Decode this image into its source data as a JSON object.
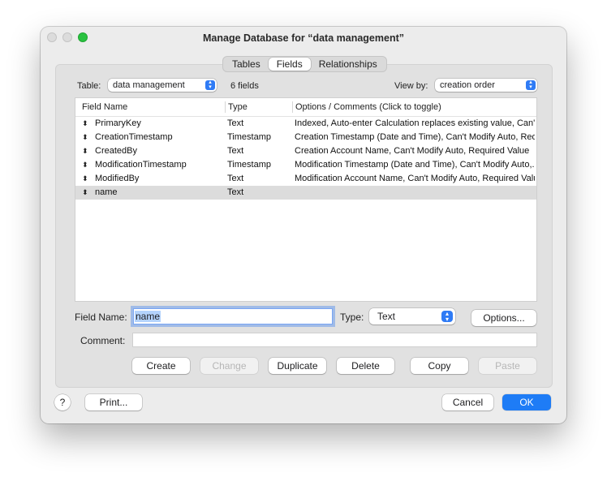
{
  "window": {
    "title": "Manage Database for “data management”"
  },
  "tabs": [
    {
      "label": "Tables"
    },
    {
      "label": "Fields",
      "selected": true
    },
    {
      "label": "Relationships"
    }
  ],
  "toolbar": {
    "table_label": "Table:",
    "table_value": "data management",
    "field_count": "6 fields",
    "viewby_label": "View by:",
    "viewby_value": "creation order"
  },
  "table": {
    "headers": [
      "Field Name",
      "Type",
      "Options / Comments   (Click to toggle)"
    ],
    "rows": [
      {
        "name": "PrimaryKey",
        "type": "Text",
        "options": "Indexed, Auto-enter Calculation replaces existing value, Can't..."
      },
      {
        "name": "CreationTimestamp",
        "type": "Timestamp",
        "options": "Creation Timestamp (Date and Time), Can't Modify Auto, Req..."
      },
      {
        "name": "CreatedBy",
        "type": "Text",
        "options": "Creation Account Name, Can't Modify Auto, Required Value"
      },
      {
        "name": "ModificationTimestamp",
        "type": "Timestamp",
        "options": "Modification Timestamp (Date and Time), Can't Modify Auto,..."
      },
      {
        "name": "ModifiedBy",
        "type": "Text",
        "options": "Modification Account Name, Can't Modify Auto, Required Value"
      },
      {
        "name": "name",
        "type": "Text",
        "options": "",
        "selected": true
      }
    ]
  },
  "form": {
    "field_name_label": "Field Name:",
    "field_name_value": "name",
    "type_label": "Type:",
    "type_value": "Text",
    "options_button": "Options...",
    "comment_label": "Comment:",
    "comment_value": ""
  },
  "actions": {
    "create": "Create",
    "change": "Change",
    "duplicate": "Duplicate",
    "delete": "Delete",
    "copy": "Copy",
    "paste": "Paste"
  },
  "footer": {
    "help": "?",
    "print": "Print...",
    "cancel": "Cancel",
    "ok": "OK"
  },
  "colors": {
    "accent": "#1e7cf6",
    "close_light": "#dcdcdc",
    "zoom_light": "#29c240"
  }
}
